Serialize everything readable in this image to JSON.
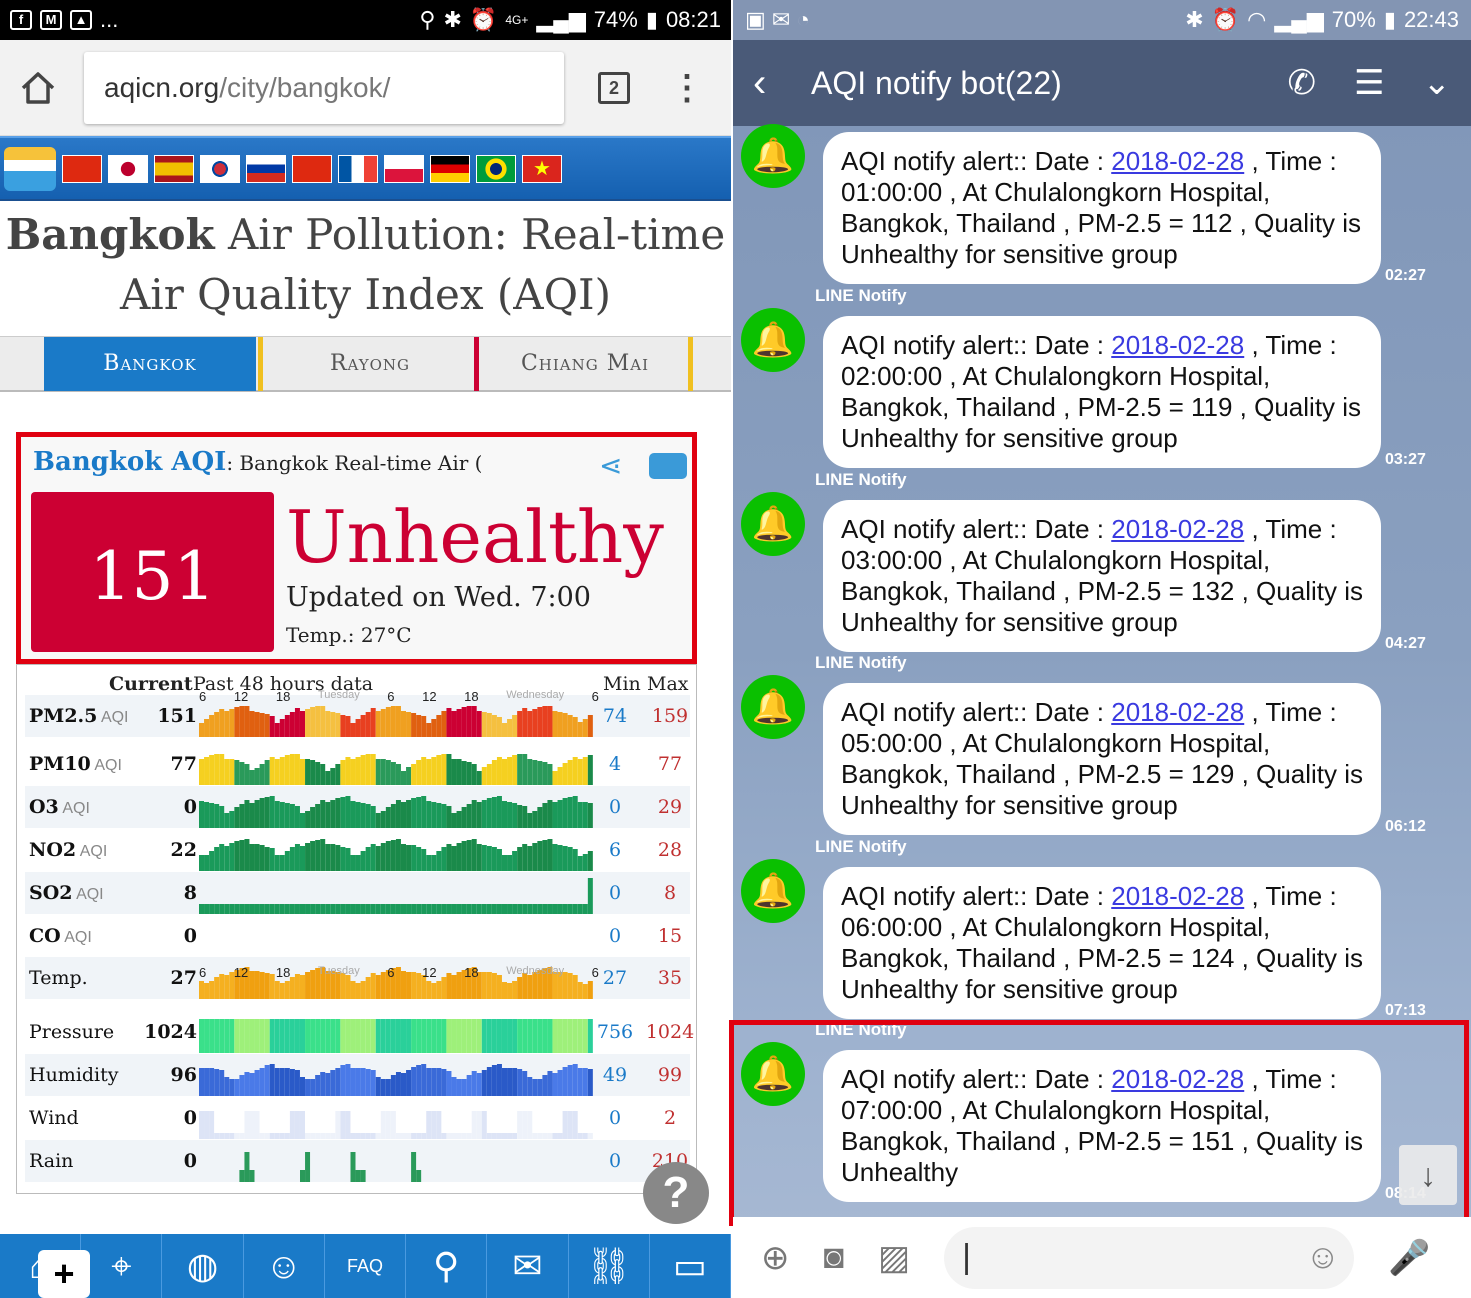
{
  "left_status": {
    "app_icons": [
      "facebook-icon",
      "gmail-icon",
      "image-icon"
    ],
    "more": "...",
    "signal": "4G+",
    "battery": "74%",
    "time": "08:21"
  },
  "browser": {
    "url_host": "aqicn.org",
    "url_path": "/city/bangkok/",
    "tab_count": "2"
  },
  "page_title": {
    "bold": "Bangkok",
    "rest1": " Air Pollution: Real-time",
    "rest2": "Air Quality Index (AQI)"
  },
  "city_tabs": [
    "Bangkok",
    "Rayong",
    "Chiang Mai"
  ],
  "aqi_card": {
    "heading": "Bangkok AQI",
    "subheading": ": Bangkok Real-time Air (",
    "value": "151",
    "status": "Unhealthy",
    "updated": "Updated on Wed. 7:00",
    "temp": "Temp.: 27°C"
  },
  "table": {
    "header_current": "Current",
    "header_past": "Past 48 hours data",
    "header_min": "Min",
    "header_max": "Max",
    "time_ticks": [
      "6",
      "12",
      "18",
      "Tuesday",
      "6",
      "12",
      "18",
      "Wednesday",
      "6"
    ],
    "rows": [
      {
        "name": "PM2.5",
        "suffix": "AQI",
        "current": "151",
        "min": "74",
        "max": "159"
      },
      {
        "name": "PM10",
        "suffix": "AQI",
        "current": "77",
        "min": "4",
        "max": "77"
      },
      {
        "name": "O3",
        "suffix": "AQI",
        "current": "0",
        "min": "0",
        "max": "29"
      },
      {
        "name": "NO2",
        "suffix": "AQI",
        "current": "22",
        "min": "6",
        "max": "28"
      },
      {
        "name": "SO2",
        "suffix": "AQI",
        "current": "8",
        "min": "0",
        "max": "8"
      },
      {
        "name": "CO",
        "suffix": "AQI",
        "current": "0",
        "min": "0",
        "max": "15"
      },
      {
        "name": "Temp.",
        "suffix": "",
        "current": "27",
        "min": "27",
        "max": "35"
      },
      {
        "name": "Pressure",
        "suffix": "",
        "current": "1024",
        "min": "756",
        "max": "1024"
      },
      {
        "name": "Humidity",
        "suffix": "",
        "current": "96",
        "min": "49",
        "max": "99"
      },
      {
        "name": "Wind",
        "suffix": "",
        "current": "0",
        "min": "0",
        "max": "2"
      },
      {
        "name": "Rain",
        "suffix": "",
        "current": "0",
        "min": "0",
        "max": "210"
      }
    ]
  },
  "help_label": "?",
  "right_status": {
    "battery": "70%",
    "time": "22:43"
  },
  "chat": {
    "title": "AQI notify bot(22)",
    "sender": "LINE Notify",
    "messages": [
      {
        "prefix": "AQI notify alert:: Date : ",
        "date": "2018-02-28",
        "l1end": " , Time :",
        "l2": "01:00:00 , At Chulalongkorn Hospital,",
        "l3": "Bangkok, Thailand , PM-2.5 = 112 , Quality is",
        "l4": "Unhealthy for sensitive group",
        "time": "02:27"
      },
      {
        "prefix": "AQI notify alert:: Date : ",
        "date": "2018-02-28",
        "l1end": " , Time :",
        "l2": "02:00:00 , At Chulalongkorn Hospital,",
        "l3": "Bangkok, Thailand , PM-2.5 = 119 , Quality is",
        "l4": "Unhealthy for sensitive group",
        "time": "03:27"
      },
      {
        "prefix": "AQI notify alert:: Date : ",
        "date": "2018-02-28",
        "l1end": " , Time :",
        "l2": "03:00:00 , At Chulalongkorn Hospital,",
        "l3": "Bangkok, Thailand , PM-2.5 = 132 , Quality is",
        "l4": "Unhealthy for sensitive group",
        "time": "04:27"
      },
      {
        "prefix": "AQI notify alert:: Date : ",
        "date": "2018-02-28",
        "l1end": " , Time :",
        "l2": "05:00:00 , At Chulalongkorn Hospital,",
        "l3": "Bangkok, Thailand , PM-2.5 = 129 , Quality is",
        "l4": "Unhealthy for sensitive group",
        "time": "06:12"
      },
      {
        "prefix": "AQI notify alert:: Date : ",
        "date": "2018-02-28",
        "l1end": " , Time :",
        "l2": "06:00:00 , At Chulalongkorn Hospital,",
        "l3": "Bangkok, Thailand , PM-2.5 = 124 , Quality is",
        "l4": "Unhealthy for sensitive group",
        "time": "07:13"
      },
      {
        "prefix": "AQI notify alert:: Date : ",
        "date": "2018-02-28",
        "l1end": " , Time :",
        "l2": "07:00:00 , At Chulalongkorn Hospital,",
        "l3": "Bangkok, Thailand , PM-2.5 = 151 , Quality is",
        "l4": "Unhealthy",
        "time": "08:14"
      }
    ]
  },
  "colors": {
    "aqi_unhealthy": "#cc0033",
    "site_blue": "#1a7ac8",
    "line_green": "#0ac000",
    "highlight_red": "#e00010"
  }
}
